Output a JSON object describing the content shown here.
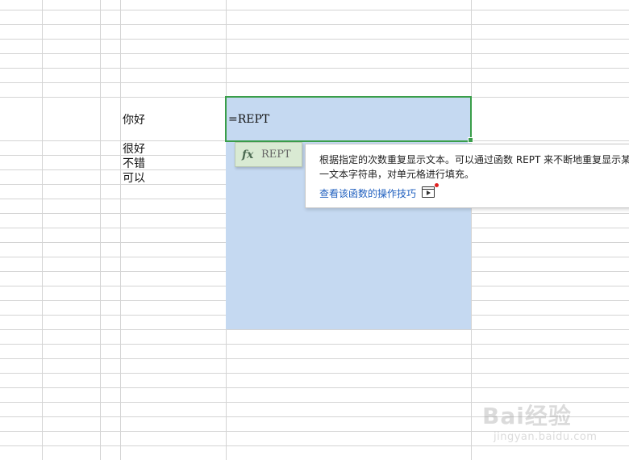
{
  "cells": {
    "b1": "你好",
    "b2": "很好",
    "b3": "不错",
    "b4": "可以"
  },
  "formula": "=REPT",
  "autocomplete": {
    "icon": "fx-icon",
    "label": "REPT"
  },
  "tooltip": {
    "description": "根据指定的次数重复显示文本。可以通过函数 REPT 来不断地重复显示某一文本字符串，对单元格进行填充。",
    "link": "查看该函数的操作技巧",
    "link_icon": "video-icon"
  },
  "watermark": {
    "logo": "Bai经验",
    "url": "jingyan.baidu.com"
  },
  "colors": {
    "selection": "#c5d9f1",
    "active_border": "#3a9e4a",
    "autocomplete_bg": "#d9ead3",
    "link": "#1f5fbf"
  }
}
